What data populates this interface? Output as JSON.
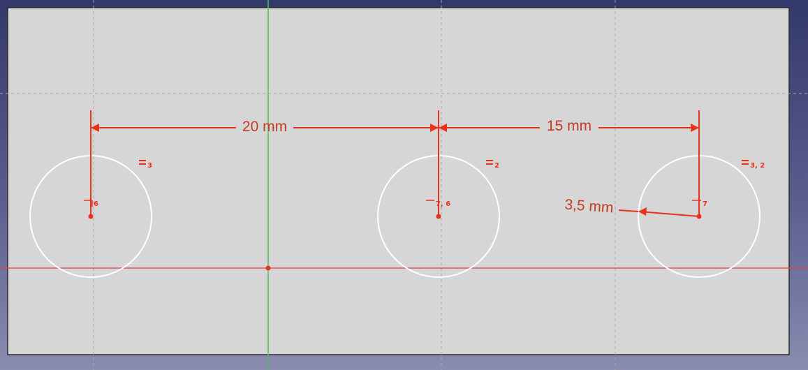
{
  "colors": {
    "background_top": "#33386a",
    "background_bottom": "#8a8db0",
    "sheet": "#d6d6d6",
    "constraint": "#e8321c",
    "dimension_text": "#c43a1f",
    "geometry": "#ffffff",
    "x_axis": "#e83c3c",
    "y_axis": "#4cc44c",
    "grid": "#a8a8a8"
  },
  "dimensions": {
    "left_distance": "20 mm",
    "right_distance": "15 mm",
    "radius": "3,5 mm"
  },
  "constraints": {
    "circle1_equal": "3",
    "circle2_equal": "2",
    "circle3_equal": "3, 2",
    "circle1_vertical": "6",
    "circle2_vertical": "7, 6",
    "circle3_vertical": "7"
  },
  "icons": {
    "equal": "equal-constraint-icon",
    "vertical": "vertical-constraint-icon"
  }
}
